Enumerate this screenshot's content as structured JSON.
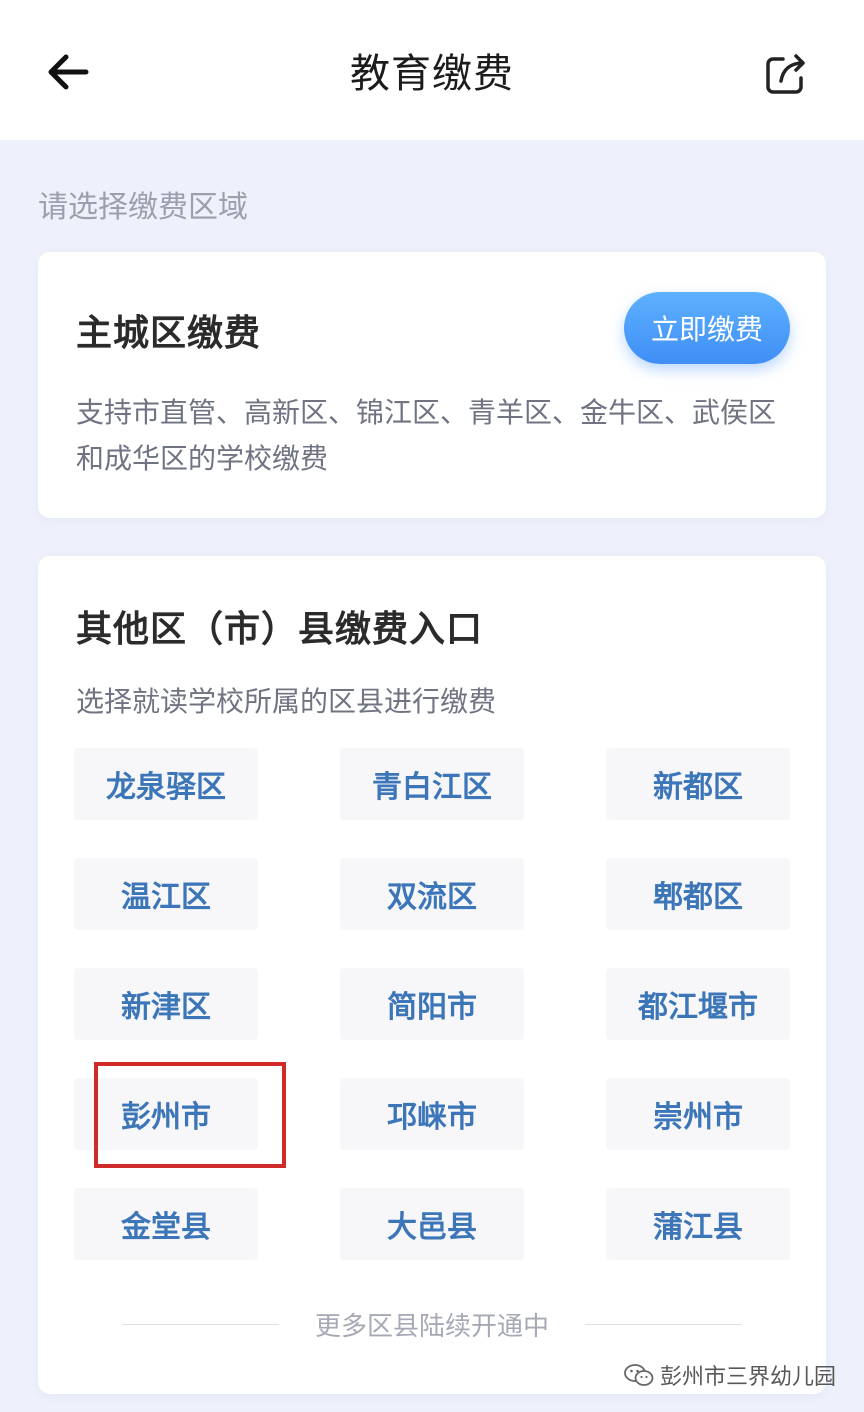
{
  "header": {
    "title": "教育缴费",
    "back_icon": "arrow-left-icon",
    "share_icon": "share-icon"
  },
  "section_hint": "请选择缴费区域",
  "main_card": {
    "title": "主城区缴费",
    "pay_button": "立即缴费",
    "description": "支持市直管、高新区、锦江区、青羊区、金牛区、武侯区和成华区的学校缴费"
  },
  "other_card": {
    "title": "其他区（市）县缴费入口",
    "subtitle": "选择就读学校所属的区县进行缴费",
    "districts": [
      "龙泉驿区",
      "青白江区",
      "新都区",
      "温江区",
      "双流区",
      "郫都区",
      "新津区",
      "简阳市",
      "都江堰市",
      "彭州市",
      "邛崃市",
      "崇州市",
      "金堂县",
      "大邑县",
      "蒲江县"
    ],
    "more_text": "更多区县陆续开通中"
  },
  "watermark": "彭州市三界幼儿园",
  "colors": {
    "accent": "#3f8ef5",
    "district_text": "#3c76b8",
    "highlight": "#d12a2a",
    "background": "#eef1fb"
  }
}
